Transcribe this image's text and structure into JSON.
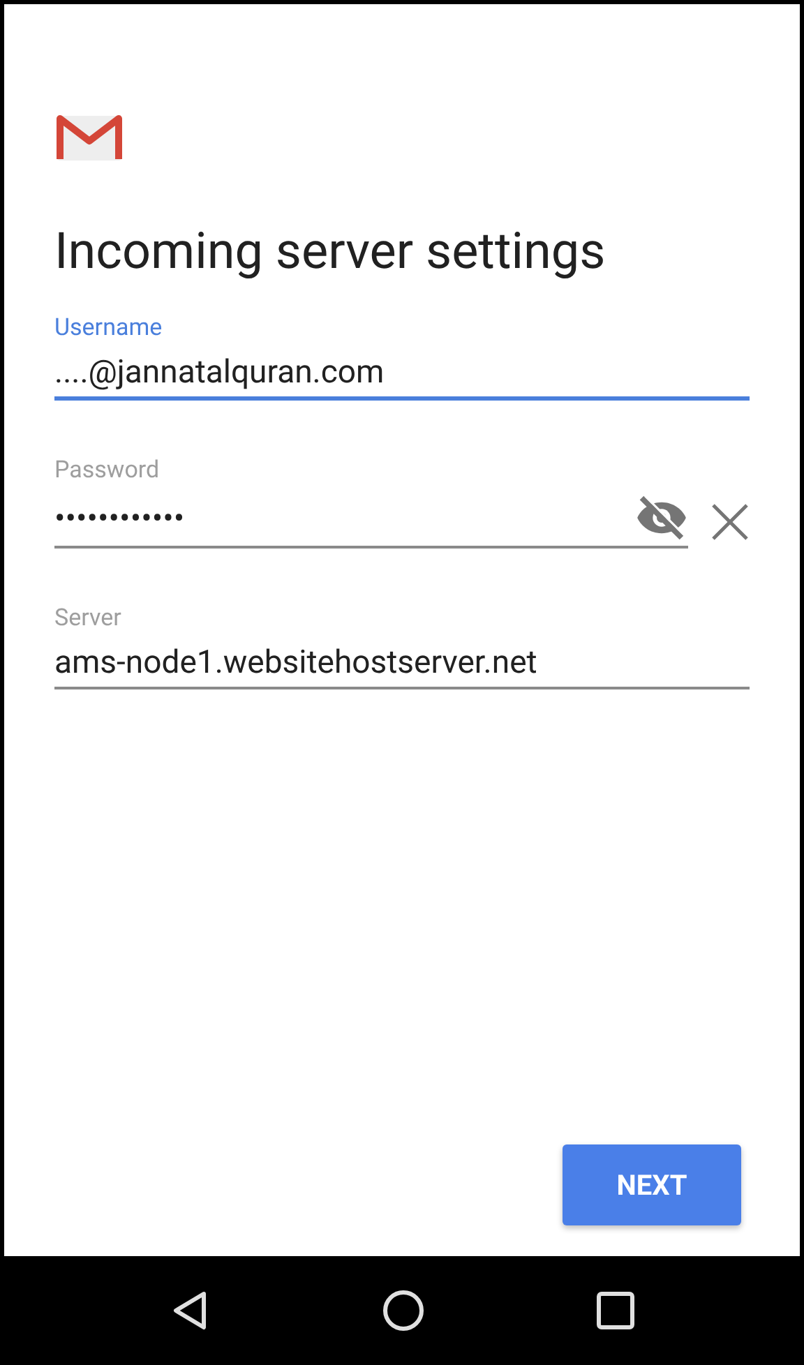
{
  "title": "Incoming server settings",
  "fields": [
    {
      "kind": "text",
      "label": "Username",
      "value": "....@jannatalquran.com",
      "focused": true
    },
    {
      "kind": "password",
      "label": "Password",
      "value": "••••••••••••",
      "focused": false,
      "visible": false
    },
    {
      "kind": "text",
      "label": "Server",
      "value": "ams-node1.websitehostserver.net",
      "focused": false
    }
  ],
  "button": "NEXT"
}
